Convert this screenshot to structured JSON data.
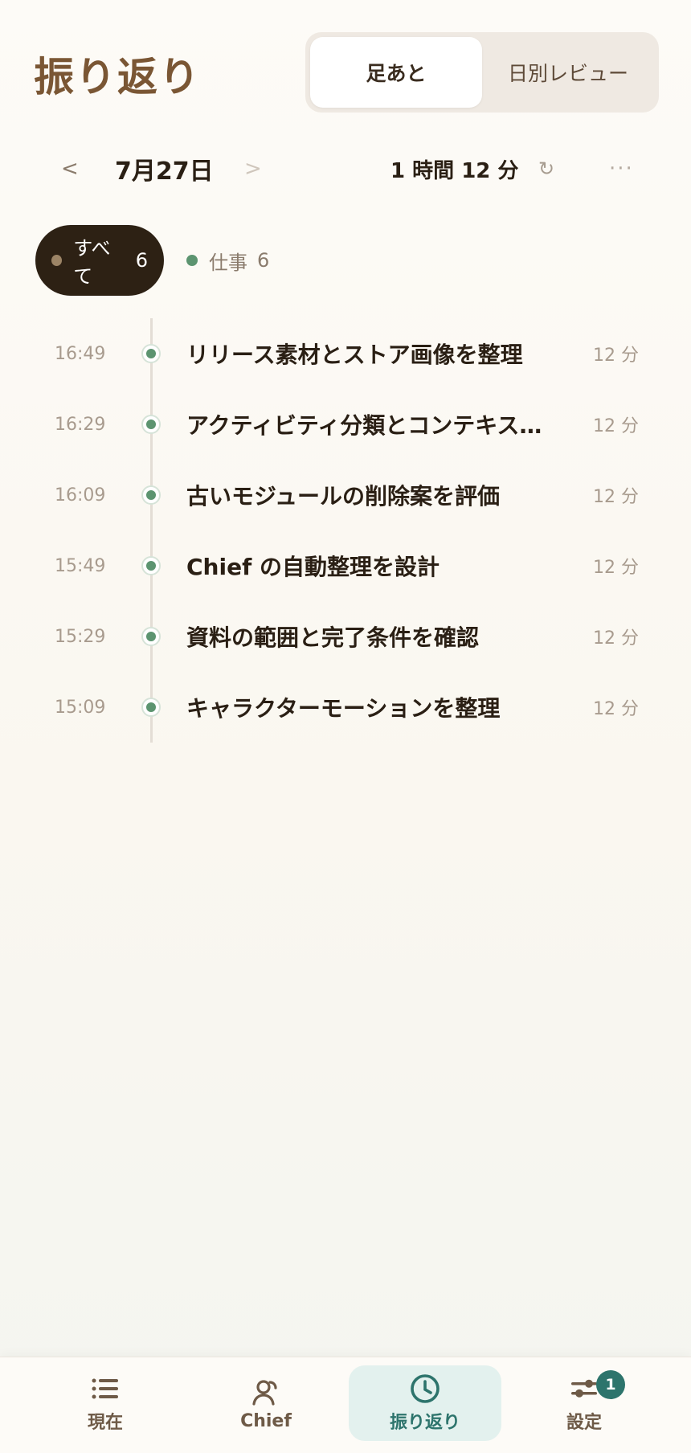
{
  "header": {
    "title": "振り返り",
    "segments": [
      {
        "label": "足あと",
        "active": true
      },
      {
        "label": "日別レビュー",
        "active": false
      }
    ]
  },
  "date_nav": {
    "prev": "<",
    "date": "7月27日",
    "next": ">",
    "total": "1 時間 12 分",
    "refresh_icon": "refresh-icon",
    "more": "···"
  },
  "filters": [
    {
      "label": "すべて",
      "count": "6",
      "color": "#9c8466",
      "active": true
    },
    {
      "label": "仕事",
      "count": "6",
      "color": "#5c9470",
      "active": false
    }
  ],
  "timeline": [
    {
      "time": "16:49",
      "title": "リリース素材とストア画像を整理",
      "duration": "12 分"
    },
    {
      "time": "16:29",
      "title": "アクティビティ分類とコンテキストの整理",
      "duration": "12 分"
    },
    {
      "time": "16:09",
      "title": "古いモジュールの削除案を評価",
      "duration": "12 分"
    },
    {
      "time": "15:49",
      "title": "Chief の自動整理を設計",
      "duration": "12 分"
    },
    {
      "time": "15:29",
      "title": "資料の範囲と完了条件を確認",
      "duration": "12 分"
    },
    {
      "time": "15:09",
      "title": "キャラクターモーションを整理",
      "duration": "12 分"
    }
  ],
  "tabbar": {
    "tabs": [
      {
        "label": "現在",
        "icon": "list-icon",
        "active": false
      },
      {
        "label": "Chief",
        "icon": "user-icon",
        "active": false
      },
      {
        "label": "振り返り",
        "icon": "clock-icon",
        "active": true
      },
      {
        "label": "設定",
        "icon": "sliders-icon",
        "active": false
      }
    ],
    "settings_badge": "1"
  },
  "colors": {
    "accent_brown": "#7a5634",
    "accent_teal": "#2d746c",
    "work_green": "#5c9470",
    "chip_dark": "#2d2114"
  }
}
